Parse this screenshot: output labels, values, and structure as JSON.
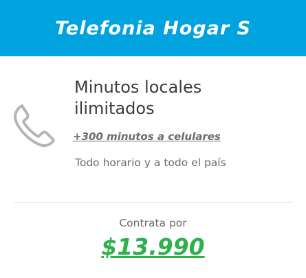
{
  "plan": {
    "title": "Telefonia Hogar S",
    "feature": {
      "icon": "phone-icon",
      "title_line1": "Minutos locales",
      "title_line2": "ilimitados",
      "extra": "+300 minutos a celulares",
      "subtitle": "Todo horario y a todo el país"
    },
    "cta_label": "Contrata por",
    "price": "$13.990"
  },
  "colors": {
    "header_bg": "#00a3dd",
    "price": "#2db14a",
    "text": "#3c3c3c",
    "muted": "#6b6b6b",
    "icon": "#b5b5b5"
  }
}
